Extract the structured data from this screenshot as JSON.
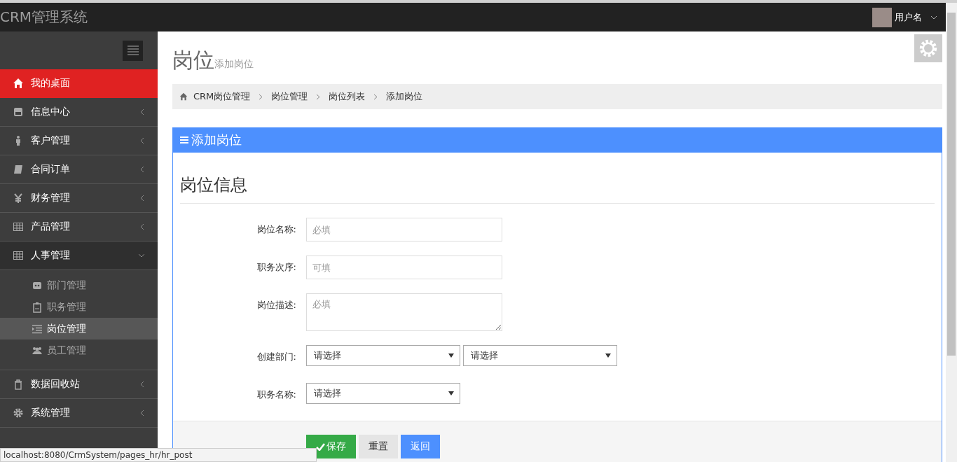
{
  "brand": "CRM管理系统",
  "user": {
    "name": "用户名"
  },
  "sidebar": {
    "items": [
      {
        "label": "我的桌面",
        "selected": true
      },
      {
        "label": "信息中心",
        "selected": false,
        "expanded": false
      },
      {
        "label": "客户管理",
        "selected": false,
        "expanded": false
      },
      {
        "label": "合同订单",
        "selected": false,
        "expanded": false
      },
      {
        "label": "财务管理",
        "selected": false,
        "expanded": false
      },
      {
        "label": "产品管理",
        "selected": false,
        "expanded": false
      },
      {
        "label": "人事管理",
        "selected": false,
        "expanded": true,
        "children": [
          {
            "label": "部门管理",
            "selected": false
          },
          {
            "label": "职务管理",
            "selected": false
          },
          {
            "label": "岗位管理",
            "selected": true
          },
          {
            "label": "员工管理",
            "selected": false
          }
        ]
      },
      {
        "label": "数据回收站",
        "selected": false,
        "expanded": false
      },
      {
        "label": "系统管理",
        "selected": false,
        "expanded": false
      }
    ]
  },
  "page": {
    "title": "岗位",
    "subtitle": "添加岗位"
  },
  "breadcrumb": [
    "CRM岗位管理",
    "岗位管理",
    "岗位列表",
    "添加岗位"
  ],
  "panel": {
    "title": "添加岗位",
    "section": "岗位信息",
    "fields": [
      {
        "kind": "text",
        "label": "岗位名称:",
        "placeholder": "必填"
      },
      {
        "kind": "text",
        "label": "职务次序:",
        "placeholder": "可填"
      },
      {
        "kind": "textarea",
        "label": "岗位描述:",
        "placeholder": "必填"
      },
      {
        "kind": "select",
        "label": "创建部门:",
        "options": [
          "请选择",
          "请选择"
        ]
      },
      {
        "kind": "select",
        "label": "职务名称:",
        "options": [
          "请选择"
        ]
      }
    ],
    "buttons": [
      {
        "kind": "save",
        "label": "保存"
      },
      {
        "kind": "reset",
        "label": "重置"
      },
      {
        "kind": "back",
        "label": "返回"
      }
    ]
  },
  "status_url": "localhost:8080/CrmSystem/pages_hr/hr_post"
}
